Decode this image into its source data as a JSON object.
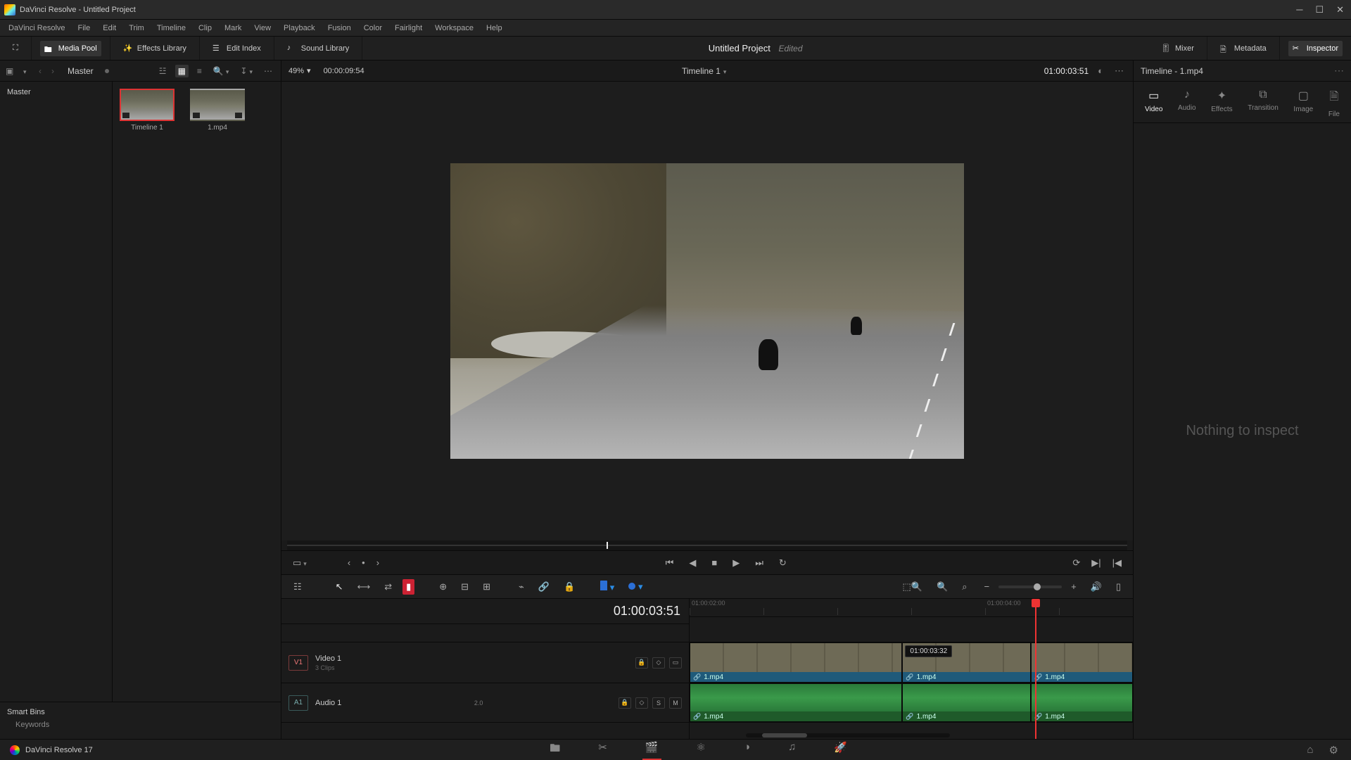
{
  "window": {
    "title": "DaVinci Resolve - Untitled Project"
  },
  "menubar": [
    "DaVinci Resolve",
    "File",
    "Edit",
    "Trim",
    "Timeline",
    "Clip",
    "Mark",
    "View",
    "Playback",
    "Fusion",
    "Color",
    "Fairlight",
    "Workspace",
    "Help"
  ],
  "ws_toolbar": {
    "media_pool": "Media Pool",
    "effects_library": "Effects Library",
    "edit_index": "Edit Index",
    "sound_library": "Sound Library",
    "project_title": "Untitled Project",
    "edited_tag": "Edited",
    "mixer": "Mixer",
    "metadata": "Metadata",
    "inspector": "Inspector"
  },
  "media_pool": {
    "master": "Master",
    "tree_root": "Master",
    "thumbs": [
      {
        "label": "Timeline 1"
      },
      {
        "label": "1.mp4"
      }
    ],
    "smart_bins": "Smart Bins",
    "keywords": "Keywords"
  },
  "viewer": {
    "zoom": "49%",
    "source_tc": "00:00:09:54",
    "timeline_name": "Timeline 1",
    "timeline_tc": "01:00:03:51"
  },
  "timeline": {
    "big_tc": "01:00:03:51",
    "ruler": [
      "01:00:02:00",
      "",
      "",
      "",
      "01:00:04:00"
    ],
    "video_track": {
      "tag": "V1",
      "name": "Video 1",
      "clips_info": "3 Clips"
    },
    "audio_track": {
      "tag": "A1",
      "name": "Audio 1",
      "level": "2.0"
    },
    "clip_label": "1.mp4",
    "hover_tc": "01:00:03:32",
    "playhead_pct": 78
  },
  "inspector": {
    "title": "Timeline - 1.mp4",
    "tabs": [
      "Video",
      "Audio",
      "Effects",
      "Transition",
      "Image",
      "File"
    ],
    "empty": "Nothing to inspect"
  },
  "footer": {
    "app": "DaVinci Resolve 17"
  }
}
